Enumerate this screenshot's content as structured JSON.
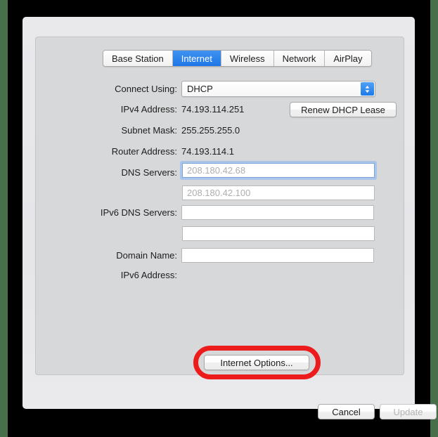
{
  "window": {
    "tabs": [
      {
        "label": "Base Station",
        "active": false
      },
      {
        "label": "Internet",
        "active": true
      },
      {
        "label": "Wireless",
        "active": false
      },
      {
        "label": "Network",
        "active": false
      },
      {
        "label": "AirPlay",
        "active": false
      }
    ]
  },
  "form": {
    "connect_using": {
      "label": "Connect Using:",
      "value": "DHCP",
      "icon": "updown-chevron-icon"
    },
    "ipv4_address": {
      "label": "IPv4 Address:",
      "value": "74.193.114.251"
    },
    "subnet_mask": {
      "label": "Subnet Mask:",
      "value": "255.255.255.0"
    },
    "router_address": {
      "label": "Router Address:",
      "value": "74.193.114.1"
    },
    "dns_servers": {
      "label": "DNS Servers:",
      "value_1": "208.180.42.68",
      "value_2": "208.180.42.100",
      "focused_field": 1
    },
    "ipv6_dns_servers": {
      "label": "IPv6 DNS Servers:",
      "value_1": "",
      "value_2": ""
    },
    "domain_name": {
      "label": "Domain Name:",
      "value": ""
    },
    "ipv6_address": {
      "label": "IPv6 Address:",
      "value": ""
    }
  },
  "buttons": {
    "renew_dhcp_lease": "Renew DHCP Lease",
    "internet_options": "Internet Options...",
    "cancel": "Cancel",
    "update": "Update"
  },
  "colors": {
    "tab_active_blue": "#2b7de9",
    "stepper_blue": "#1d7ae9",
    "focus_ring_blue": "#a9c5e9",
    "annotation_red": "#ed1c1c",
    "window_bg": "#e8e8eb",
    "panel_bg": "#d7d8da",
    "desktop_green": "#47704a"
  },
  "annotation": {
    "shape": "rounded-rectangle-highlight",
    "targets": "internet-options-button"
  }
}
